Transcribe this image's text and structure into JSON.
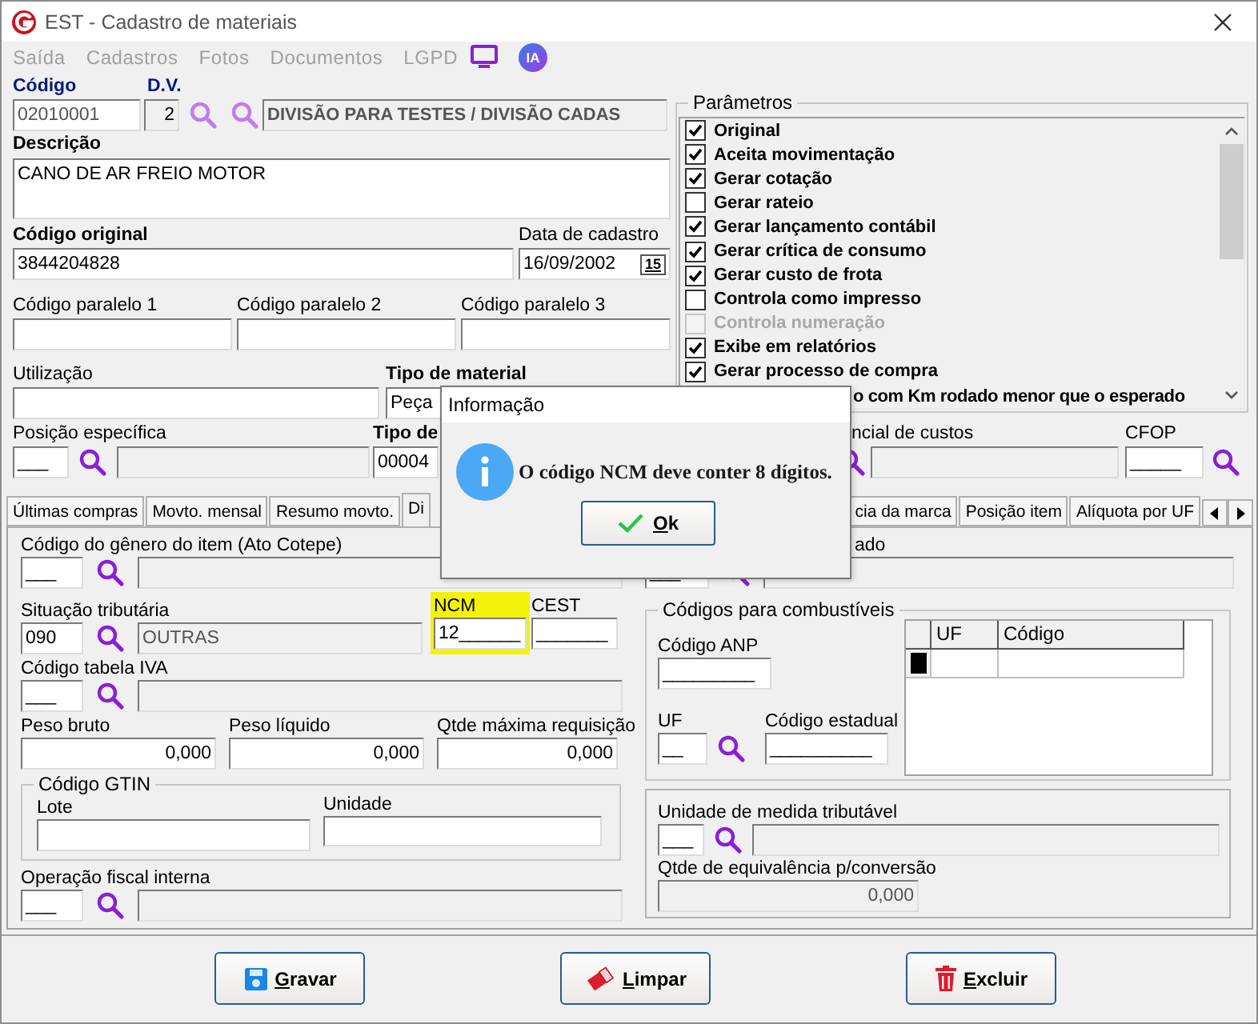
{
  "window": {
    "title": "EST - Cadastro de materiais"
  },
  "menu": [
    {
      "label": "Saída",
      "disabled": true
    },
    {
      "label": "Cadastros",
      "disabled": true
    },
    {
      "label": "Fotos",
      "disabled": true
    },
    {
      "label": "Documentos",
      "disabled": true
    },
    {
      "label": "LGPD",
      "disabled": true
    }
  ],
  "ia_badge": "IA",
  "codigo": {
    "label": "Código",
    "value": "02010001"
  },
  "dv": {
    "label": "D.V.",
    "value": "2"
  },
  "divisao": {
    "value": "DIVISÃO PARA TESTES / DIVISÃO CADAS"
  },
  "descricao": {
    "label": "Descrição",
    "value": "CANO DE AR FREIO MOTOR"
  },
  "codigo_original": {
    "label": "Código original",
    "value": "3844204828"
  },
  "data_cadastro": {
    "label": "Data de cadastro",
    "value": "16/09/2002",
    "calendar": "15"
  },
  "paralelos": [
    {
      "label": "Código paralelo 1"
    },
    {
      "label": "Código paralelo 2"
    },
    {
      "label": "Código paralelo 3"
    }
  ],
  "utilizacao": {
    "label": "Utilização"
  },
  "tipo_material": {
    "label": "Tipo de material",
    "value": "Peça"
  },
  "posicao_especifica": {
    "label": "Posição específica",
    "value": "___"
  },
  "tipo_de": {
    "label": "Tipo de",
    "value": "00004"
  },
  "custos": {
    "label": "ncial de custos"
  },
  "cfop": {
    "label": "CFOP",
    "value": "_____"
  },
  "params": {
    "title": "Parâmetros",
    "items": [
      {
        "label": "Original",
        "checked": true,
        "disabled": false
      },
      {
        "label": "Aceita movimentação",
        "checked": true,
        "disabled": false
      },
      {
        "label": "Gerar cotação",
        "checked": true,
        "disabled": false
      },
      {
        "label": "Gerar rateio",
        "checked": false,
        "disabled": false
      },
      {
        "label": "Gerar lançamento contábil",
        "checked": true,
        "disabled": false
      },
      {
        "label": "Gerar crítica de consumo",
        "checked": true,
        "disabled": false
      },
      {
        "label": "Gerar custo de frota",
        "checked": true,
        "disabled": false
      },
      {
        "label": "Controla como impresso",
        "checked": false,
        "disabled": false
      },
      {
        "label": "Controla numeração",
        "checked": false,
        "disabled": true
      },
      {
        "label": "Exibe em relatórios",
        "checked": true,
        "disabled": false
      },
      {
        "label": "Gerar processo de compra",
        "checked": true,
        "disabled": false
      }
    ],
    "partial_item": "o com Km rodado menor que o esperado"
  },
  "tabs": [
    {
      "label": "Últimas compras",
      "selected": false
    },
    {
      "label": "Movto. mensal",
      "selected": false
    },
    {
      "label": "Resumo movto.",
      "selected": false
    },
    {
      "label": "Di",
      "selected": true
    },
    {
      "label": "cia da marca",
      "selected": false
    },
    {
      "label": "Posição item",
      "selected": false
    },
    {
      "label": "Alíquota por UF",
      "selected": false
    }
  ],
  "panel": {
    "genero": {
      "label": "Código do gênero do item (Ato Cotepe)",
      "value": "___"
    },
    "situacao": {
      "label": "Situação tributária",
      "value": "090",
      "description": "OUTRAS"
    },
    "ncm": {
      "label": "NCM",
      "value": "12______",
      "highlighted": true
    },
    "cest": {
      "label": "CEST",
      "value": "_______"
    },
    "iva": {
      "label": "Código tabela IVA",
      "value": "___"
    },
    "pesos": [
      {
        "label": "Peso bruto",
        "value": "0,000"
      },
      {
        "label": "Peso líquido",
        "value": "0,000"
      },
      {
        "label": "Qtde máxima requisição",
        "value": "0,000"
      }
    ],
    "gtin": {
      "title": "Código GTIN",
      "lote": "Lote",
      "unidade": "Unidade"
    },
    "operacao": {
      "label": "Operação fiscal interna",
      "value": "___"
    },
    "partial_label": "ado",
    "partial_value": "___",
    "combustiveis": {
      "title": "Códigos para combustíveis",
      "anp": {
        "label": "Código ANP",
        "value": "_________"
      },
      "uf": {
        "label": "UF",
        "value": "__"
      },
      "estadual": {
        "label": "Código estadual",
        "value": "__________"
      },
      "columns": [
        "UF",
        "Código"
      ]
    },
    "unidade_tributavel": {
      "label": "Unidade de medida tributável",
      "value": "___"
    },
    "equivalencia": {
      "label": "Qtde de equivalência p/conversão",
      "value": "0,000"
    }
  },
  "buttons": [
    {
      "label": "Gravar",
      "kind": "save"
    },
    {
      "label": "Limpar",
      "kind": "clear"
    },
    {
      "label": "Excluir",
      "kind": "delete"
    }
  ],
  "dialog": {
    "title": "Informação",
    "message": "O código NCM deve conter 8 dígitos.",
    "button": "Ok"
  }
}
